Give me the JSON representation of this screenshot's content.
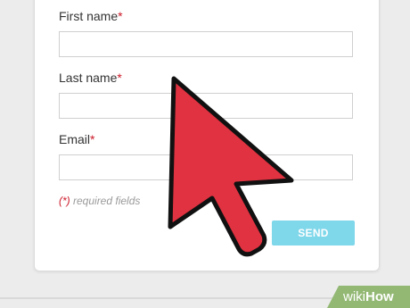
{
  "form": {
    "first_name_label": "First name",
    "last_name_label": "Last name",
    "email_label": "Email",
    "required_marker": "*",
    "first_name_value": "",
    "last_name_value": "",
    "email_value": "",
    "required_note_marker": "(*)",
    "required_note_text": " required fields",
    "send_label": "SEND"
  },
  "watermark": {
    "prefix": "wiki",
    "suffix": "How"
  },
  "colors": {
    "required": "#cc1a2a",
    "send_button": "#7fd7ea",
    "cursor_fill": "#e03240",
    "watermark_bg": "#93b874"
  },
  "icons": {
    "cursor": "mouse-pointer-arrow-icon"
  }
}
